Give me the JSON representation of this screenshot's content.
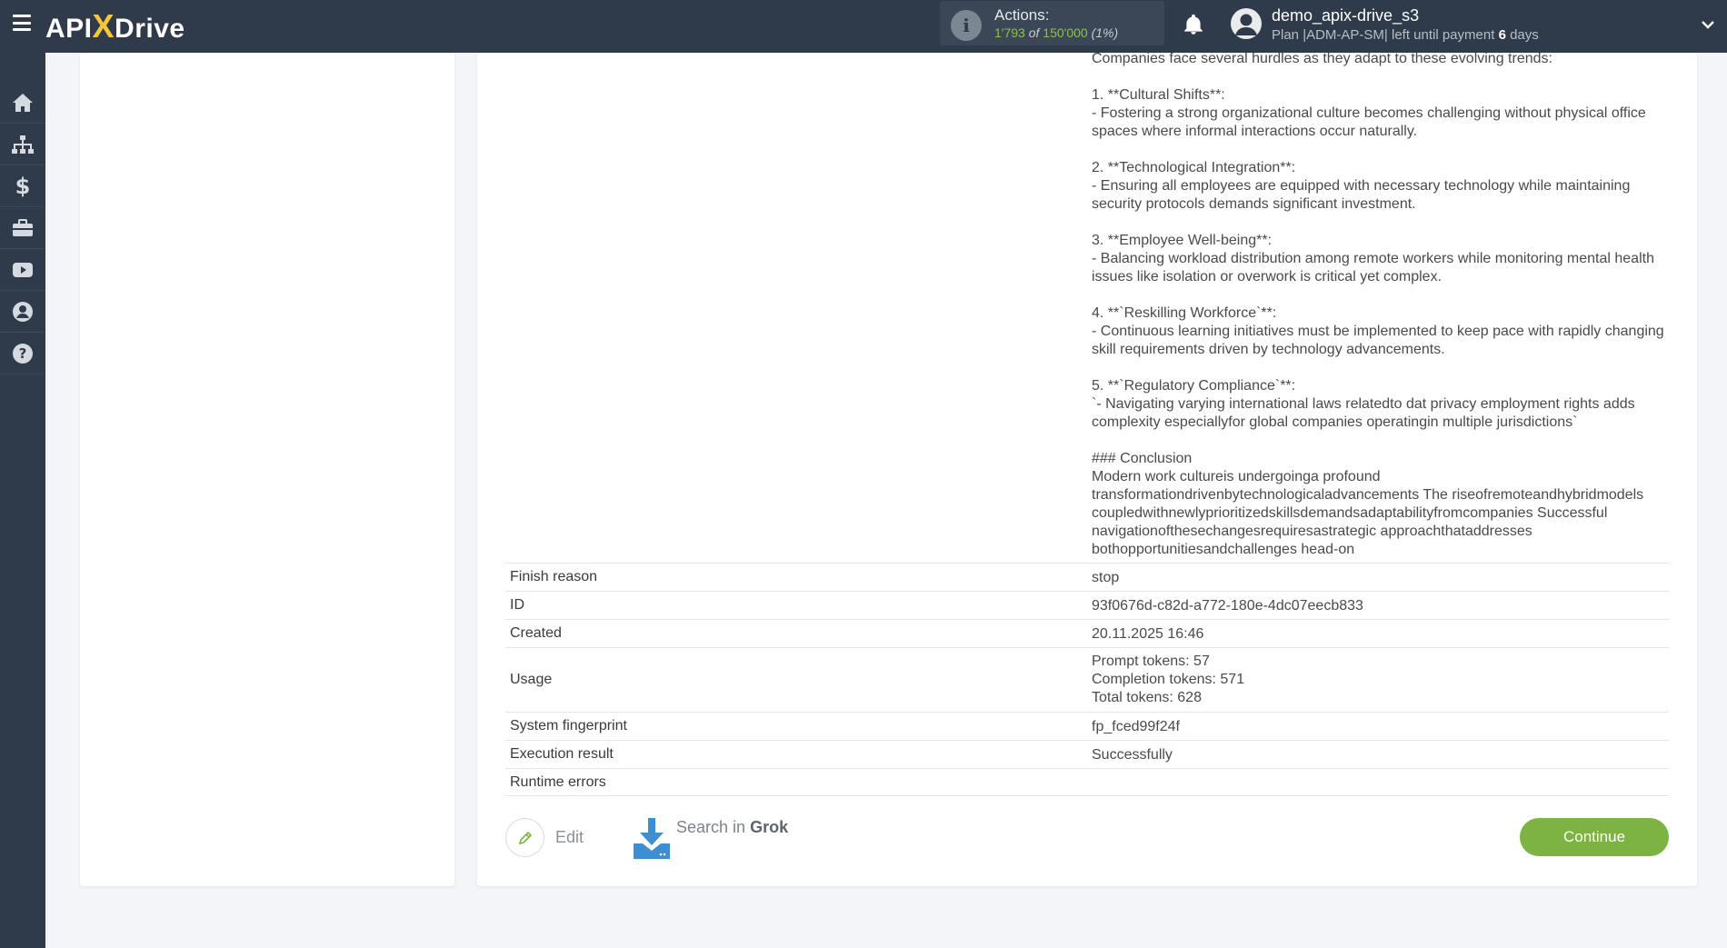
{
  "topbar": {
    "logo": {
      "api": "API",
      "x": "X",
      "drive": "Drive"
    },
    "actions": {
      "label": "Actions:",
      "used": "1'793",
      "of": "of",
      "total": "150'000",
      "percent": "(1%)"
    },
    "user": {
      "name": "demo_apix-drive_s3",
      "plan_prefix": "Plan |ADM-AP-SM| left until payment",
      "days": "6",
      "days_suffix": "days"
    }
  },
  "sidebar": {
    "items": [
      "home-icon",
      "sitemap-icon",
      "dollar-icon",
      "briefcase-icon",
      "video-icon",
      "user-icon",
      "help-icon"
    ]
  },
  "answer": {
    "text": "Companies face several hurdles as they adapt to these evolving trends:\n\n1. **Cultural Shifts**:\n- Fostering a strong organizational culture becomes challenging without physical office spaces where informal interactions occur naturally.\n\n2. **Technological Integration**:\n- Ensuring all employees are equipped with necessary technology while maintaining security protocols demands significant investment.\n\n3. **Employee Well-being**:\n- Balancing workload distribution among remote workers while monitoring mental health issues like isolation or overwork is critical yet complex.\n\n4. **`Reskilling Workforce`**:\n- Continuous learning initiatives must be implemented to keep pace with rapidly changing skill requirements driven by technology advancements.\n\n5. **`Regulatory Compliance`**:\n`- Navigating varying international laws relatedto dat privacy employment rights adds complexity especiallyfor global companies operatingin multiple jurisdictions`\n\n### Conclusion\nModern work cultureis undergoinga profound transformationdrivenbytechnologicaladvancements The riseofremoteandhybridmodels coupledwithnewlyprioritizedskillsdemandsadaptabilityfromcompanies Successful navigationofthesechangesrequiresastrategic approachthataddresses bothopportunitiesandchallenges head-on"
  },
  "table": {
    "rows": [
      {
        "key": "Finish reason",
        "value": "stop"
      },
      {
        "key": "ID",
        "value": "93f0676d-c82d-a772-180e-4dc07eecb833"
      },
      {
        "key": "Created",
        "value": "20.11.2025 16:46"
      },
      {
        "key": "Usage",
        "value": "Prompt tokens: 57\nCompletion tokens: 571\nTotal tokens: 628"
      },
      {
        "key": "System fingerprint",
        "value": "fp_fced99f24f"
      },
      {
        "key": "Execution result",
        "value": "Successfully"
      },
      {
        "key": "Runtime errors",
        "value": ""
      }
    ]
  },
  "footer": {
    "edit_label": "Edit",
    "search_prefix": "Search in",
    "search_brand": "Grok",
    "continue_label": "Continue"
  },
  "colors": {
    "topbar": "#2f3b4a",
    "accent_green": "#7cb342",
    "logo_yellow": "#f7c53a",
    "download_blue": "#3d8fd1"
  }
}
